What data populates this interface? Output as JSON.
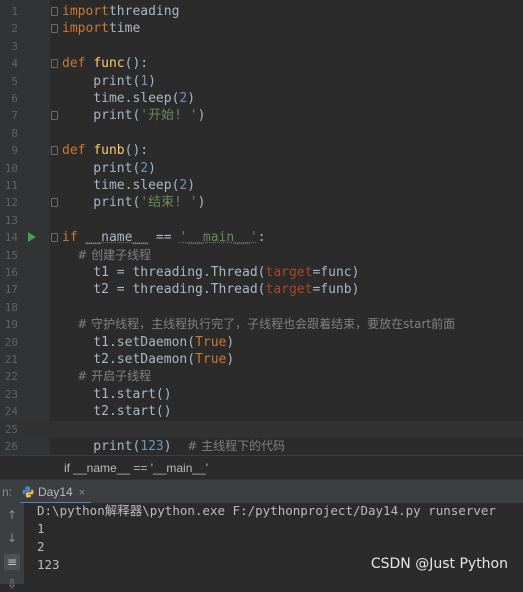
{
  "editor": {
    "current_line": 25,
    "lines": [
      {
        "n": "1",
        "tokens": [
          [
            "kw",
            "import"
          ],
          [
            "",
            "threading"
          ]
        ],
        "fold": true
      },
      {
        "n": "2",
        "tokens": [
          [
            "kw",
            "import"
          ],
          [
            "",
            "time"
          ]
        ],
        "fold": true
      },
      {
        "n": "3",
        "tokens": []
      },
      {
        "n": "4",
        "tokens": [
          [
            "kw",
            "def "
          ],
          [
            "fn",
            "func"
          ],
          [
            "",
            "():"
          ]
        ],
        "fold": true
      },
      {
        "n": "5",
        "tokens": [
          [
            "",
            "    print("
          ],
          [
            "num",
            "1"
          ],
          [
            "",
            ")"
          ]
        ]
      },
      {
        "n": "6",
        "tokens": [
          [
            "",
            "    time.sleep("
          ],
          [
            "num",
            "2"
          ],
          [
            "",
            ")"
          ]
        ]
      },
      {
        "n": "7",
        "tokens": [
          [
            "",
            "    print("
          ],
          [
            "str",
            "'开始! '"
          ],
          [
            "",
            ")"
          ]
        ],
        "fold": true
      },
      {
        "n": "8",
        "tokens": []
      },
      {
        "n": "9",
        "tokens": [
          [
            "kw",
            "def "
          ],
          [
            "fn",
            "funb"
          ],
          [
            "",
            "():"
          ]
        ],
        "fold": true
      },
      {
        "n": "10",
        "tokens": [
          [
            "",
            "    print("
          ],
          [
            "num",
            "2"
          ],
          [
            "",
            ")"
          ]
        ]
      },
      {
        "n": "11",
        "tokens": [
          [
            "",
            "    time.sleep("
          ],
          [
            "num",
            "2"
          ],
          [
            "",
            ")"
          ]
        ]
      },
      {
        "n": "12",
        "tokens": [
          [
            "",
            "    print("
          ],
          [
            "str",
            "'结束! '"
          ],
          [
            "",
            ")"
          ]
        ],
        "fold": true
      },
      {
        "n": "13",
        "tokens": []
      },
      {
        "n": "14",
        "tokens": [
          [
            "kw",
            "if "
          ],
          [
            "",
            "__name__"
          ],
          [
            "",
            " == "
          ],
          [
            "str",
            "'__main__'"
          ],
          [
            "",
            ":"
          ]
        ],
        "fold": true,
        "run": true
      },
      {
        "n": "15",
        "tokens": [
          [
            "cm",
            "    # 创建子线程"
          ]
        ]
      },
      {
        "n": "16",
        "tokens": [
          [
            "",
            "    t1 = threading.Thread("
          ],
          [
            "kwarg",
            "target"
          ],
          [
            "",
            "=func)"
          ]
        ]
      },
      {
        "n": "17",
        "tokens": [
          [
            "",
            "    t2 = threading.Thread("
          ],
          [
            "kwarg",
            "target"
          ],
          [
            "",
            "=funb)"
          ]
        ]
      },
      {
        "n": "18",
        "tokens": []
      },
      {
        "n": "19",
        "tokens": [
          [
            "cm",
            "    # 守护线程，主线程执行完了，子线程也会跟着结束，要放在start前面"
          ]
        ]
      },
      {
        "n": "20",
        "tokens": [
          [
            "",
            "    t1.setDaemon("
          ],
          [
            "kw",
            "True"
          ],
          [
            "",
            ")"
          ]
        ]
      },
      {
        "n": "21",
        "tokens": [
          [
            "",
            "    t2.setDaemon("
          ],
          [
            "kw",
            "True"
          ],
          [
            "",
            ")"
          ]
        ]
      },
      {
        "n": "22",
        "tokens": [
          [
            "cm",
            "    # 开启子线程"
          ]
        ]
      },
      {
        "n": "23",
        "tokens": [
          [
            "",
            "    t1.start()"
          ]
        ]
      },
      {
        "n": "24",
        "tokens": [
          [
            "",
            "    t2.start()"
          ]
        ]
      },
      {
        "n": "25",
        "tokens": []
      },
      {
        "n": "26",
        "tokens": [
          [
            "",
            "    print("
          ],
          [
            "num",
            "123"
          ],
          [
            "",
            ")  "
          ],
          [
            "cm",
            "# 主线程下的代码"
          ]
        ]
      }
    ]
  },
  "breadcrumb": {
    "text": "if __name__ == '__main__'"
  },
  "run_panel": {
    "tab_label": "Day14",
    "close_glyph": "×",
    "edge_label": "n:",
    "output": [
      "D:\\python解释器\\python.exe F:/pythonproject/Day14.py runserver",
      "1",
      "2",
      "123"
    ]
  },
  "watermark": "CSDN @Just Python"
}
